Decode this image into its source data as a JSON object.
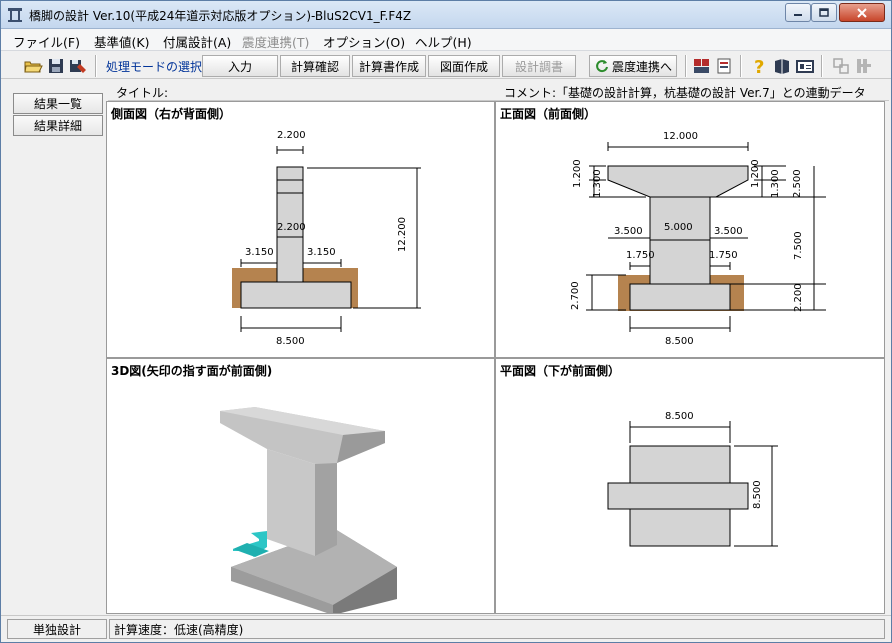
{
  "window": {
    "title": "橋脚の設計 Ver.10(平成24年道示対応版オプション)-BluS2CV1_F.F4Z"
  },
  "menu": [
    {
      "label": "ファイル(F)",
      "enabled": true
    },
    {
      "label": "基準値(K)",
      "enabled": true
    },
    {
      "label": "付属設計(A)",
      "enabled": true
    },
    {
      "label": "震度連携(T)",
      "enabled": false
    },
    {
      "label": "オプション(O)",
      "enabled": true
    },
    {
      "label": "ヘルプ(H)",
      "enabled": true
    }
  ],
  "toolbar": {
    "mode_label": "処理モードの選択",
    "buttons": {
      "input": "入力",
      "calc_check": "計算確認",
      "report": "計算書作成",
      "drawing": "図面作成",
      "design_survey": "設計調書",
      "seismic_link": "震度連携へ"
    }
  },
  "sidebar": {
    "results_list": "結果一覧",
    "results_detail": "結果詳細"
  },
  "info": {
    "title_label": "タイトル:",
    "comment": "コメント:「基礎の設計計算，杭基礎の設計 Ver.7」との連動データ"
  },
  "panels": {
    "side": {
      "title": "側面図（右が背面側）",
      "dims": {
        "top_width": "2.200",
        "mid_width": "2.200",
        "left_offset": "3.150",
        "right_offset": "3.150",
        "height": "12.200",
        "base_width": "8.500"
      }
    },
    "front": {
      "title": "正面図（前面側）",
      "dims": {
        "top_width": "12.000",
        "h1": "1.200",
        "h2": "1.300",
        "h3": "1.200",
        "h4": "1.300",
        "h5": "2.500",
        "left_cant": "3.500",
        "col_width": "5.000",
        "right_cant": "3.500",
        "left_foot": "1.750",
        "right_foot": "1.750",
        "col_height": "7.500",
        "foot_height_left": "2.700",
        "foot_height_right": "2.200",
        "base_width": "8.500"
      }
    },
    "iso": {
      "title": "3D図(矢印の指す面が前面側)"
    },
    "plan": {
      "title": "平面図（下が前面側）",
      "dims": {
        "width": "8.500",
        "depth": "8.500"
      }
    }
  },
  "status": {
    "mode": "単独設計",
    "speed": "計算速度：低速(高精度)"
  }
}
